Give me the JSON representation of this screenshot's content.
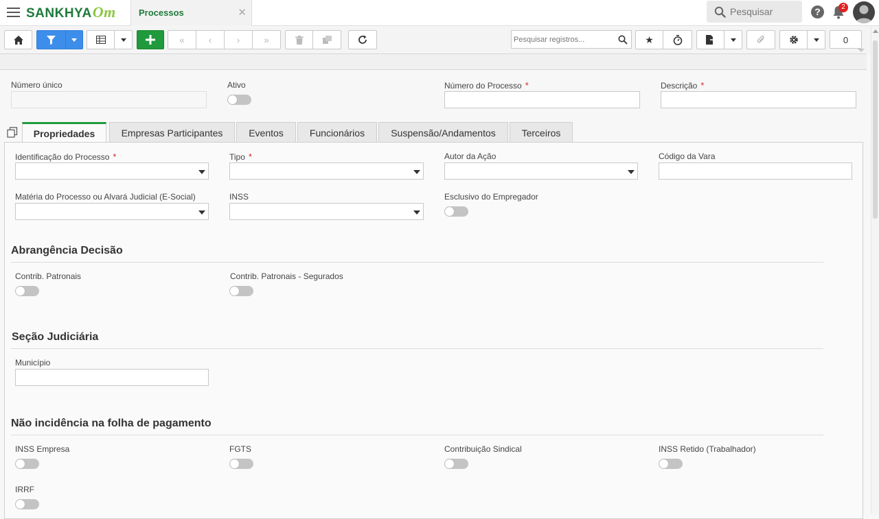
{
  "header": {
    "logo_text": "SANKHYA",
    "logo_suffix": "Om",
    "tab_title": "Processos",
    "search_placeholder": "Pesquisar",
    "notification_count": "2"
  },
  "toolbar": {
    "record_search_placeholder": "Pesquisar registros...",
    "counter": "0"
  },
  "form": {
    "fields": {
      "numero_unico": "Número único",
      "ativo": "Ativo",
      "numero_processo": "Número do Processo",
      "descricao": "Descrição"
    },
    "required_mark": "*"
  },
  "tabs": [
    {
      "label": "Propriedades"
    },
    {
      "label": "Empresas Participantes"
    },
    {
      "label": "Eventos"
    },
    {
      "label": "Funcionários"
    },
    {
      "label": "Suspensão/Andamentos"
    },
    {
      "label": "Terceiros"
    }
  ],
  "properties": {
    "identificacao": "Identificação do Processo",
    "tipo": "Tipo",
    "autor": "Autor da Ação",
    "codigo_vara": "Código da Vara",
    "materia": "Matéria do Processo ou Alvará Judicial (E-Social)",
    "inss": "INSS",
    "exclusivo": "Esclusivo do Empregador"
  },
  "sections": {
    "abrangencia": {
      "title": "Abrangência Decisão",
      "contrib_patronais": "Contrib. Patronais",
      "contrib_segurados": "Contrib. Patronais - Segurados"
    },
    "secao_judiciaria": {
      "title": "Seção Judiciária",
      "municipio": "Município"
    },
    "nao_incidencia": {
      "title": "Não incidência na folha de pagamento",
      "inss_empresa": "INSS Empresa",
      "fgts": "FGTS",
      "contribuicao_sindical": "Contribuição Sindical",
      "inss_retido": "INSS Retido (Trabalhador)",
      "irrf": "IRRF"
    }
  },
  "colors": {
    "brand_green": "#1d7a3b",
    "accent_blue": "#3d8eea",
    "add_green": "#1f9a3c",
    "required_red": "#d62828"
  },
  "icons": [
    "menu-icon",
    "home-icon",
    "filter-icon",
    "grid-icon",
    "plus-icon",
    "first-icon",
    "prev-icon",
    "next-icon",
    "last-icon",
    "trash-icon",
    "copy-icon",
    "refresh-icon",
    "search-icon",
    "star-icon",
    "timer-icon",
    "export-icon",
    "attach-icon",
    "gear-icon",
    "help-icon",
    "bell-icon",
    "user-icon"
  ]
}
